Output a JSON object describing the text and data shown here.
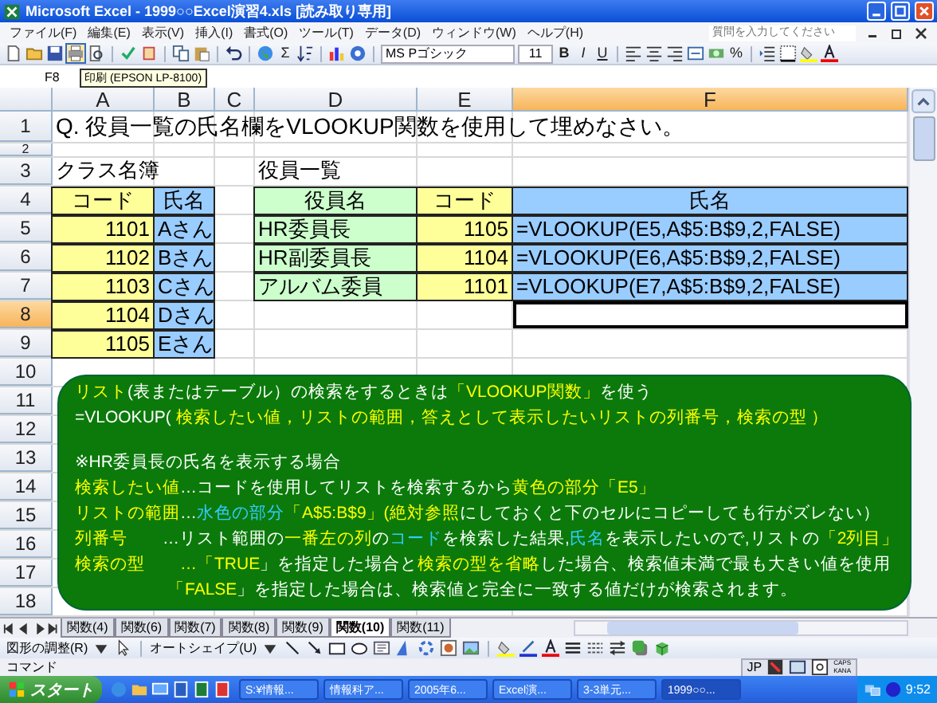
{
  "window": {
    "title": "Microsoft Excel - 1999○○Excel演習4.xls [読み取り専用]"
  },
  "menu": [
    "ファイル(F)",
    "編集(E)",
    "表示(V)",
    "挿入(I)",
    "書式(O)",
    "ツール(T)",
    "データ(D)",
    "ウィンドウ(W)",
    "ヘルプ(H)"
  ],
  "help_box": {
    "placeholder": "質問を入力してください"
  },
  "toolbar": {
    "font": "MS Pゴシック",
    "size": "11",
    "bold": "B",
    "italic": "I",
    "underline": "U",
    "sum": "Σ",
    "percent": "%"
  },
  "tooltip": "印刷 (EPSON LP-8100)",
  "name_box": "F8",
  "columns": [
    {
      "label": "A",
      "selected": false
    },
    {
      "label": "B",
      "selected": false
    },
    {
      "label": "C",
      "selected": false
    },
    {
      "label": "D",
      "selected": false
    },
    {
      "label": "E",
      "selected": false
    },
    {
      "label": "F",
      "selected": true
    }
  ],
  "rows": [
    {
      "label": "1",
      "selected": false,
      "A": {
        "text": "Q. 役員一覧の氏名欄をVLOOKUP関数を使用して埋めなさい。",
        "kind": "title"
      }
    },
    {
      "label": "2",
      "selected": false
    },
    {
      "label": "3",
      "selected": false,
      "A": {
        "text": "クラス名簿",
        "kind": "text"
      },
      "D": {
        "text": "役員一覧",
        "kind": "text"
      }
    },
    {
      "label": "4",
      "selected": false,
      "A": {
        "text": "コード",
        "kind": "header",
        "color": "#ffff99"
      },
      "B": {
        "text": "氏名",
        "kind": "header",
        "color": "#99ccff"
      },
      "D": {
        "text": "役員名",
        "kind": "header",
        "color": "#ccffcc"
      },
      "E": {
        "text": "コード",
        "kind": "header",
        "color": "#ffff99"
      },
      "F": {
        "text": "氏名",
        "kind": "header",
        "color": "#99ccff"
      }
    },
    {
      "label": "5",
      "selected": false,
      "A": {
        "text": "1101",
        "kind": "number",
        "color": "#ffff99"
      },
      "B": {
        "text": "Aさん",
        "kind": "text",
        "color": "#99ccff"
      },
      "D": {
        "text": "HR委員長",
        "kind": "text",
        "color": "#ccffcc"
      },
      "E": {
        "text": "1105",
        "kind": "number",
        "color": "#ffff99"
      },
      "F": {
        "text": "=VLOOKUP(E5,A$5:B$9,2,FALSE)",
        "kind": "text",
        "color": "#99ccff"
      }
    },
    {
      "label": "6",
      "selected": false,
      "A": {
        "text": "1102",
        "kind": "number",
        "color": "#ffff99"
      },
      "B": {
        "text": "Bさん",
        "kind": "text",
        "color": "#99ccff"
      },
      "D": {
        "text": "HR副委員長",
        "kind": "text",
        "color": "#ccffcc"
      },
      "E": {
        "text": "1104",
        "kind": "number",
        "color": "#ffff99"
      },
      "F": {
        "text": "=VLOOKUP(E6,A$5:B$9,2,FALSE)",
        "kind": "text",
        "color": "#99ccff"
      }
    },
    {
      "label": "7",
      "selected": false,
      "A": {
        "text": "1103",
        "kind": "number",
        "color": "#ffff99"
      },
      "B": {
        "text": "Cさん",
        "kind": "text",
        "color": "#99ccff"
      },
      "D": {
        "text": "アルバム委員",
        "kind": "text",
        "color": "#ccffcc"
      },
      "E": {
        "text": "1101",
        "kind": "number",
        "color": "#ffff99"
      },
      "F": {
        "text": "=VLOOKUP(E7,A$5:B$9,2,FALSE)",
        "kind": "text",
        "color": "#99ccff"
      }
    },
    {
      "label": "8",
      "selected": true,
      "A": {
        "text": "1104",
        "kind": "number",
        "color": "#ffff99"
      },
      "B": {
        "text": "Dさん",
        "kind": "text",
        "color": "#99ccff"
      },
      "F": {
        "selected": true
      }
    },
    {
      "label": "9",
      "selected": false,
      "A": {
        "text": "1105",
        "kind": "number",
        "color": "#ffff99"
      },
      "B": {
        "text": "Eさん",
        "kind": "text",
        "color": "#99ccff"
      }
    },
    {
      "label": "10",
      "selected": false
    },
    {
      "label": "11",
      "selected": false
    },
    {
      "label": "12",
      "selected": false
    },
    {
      "label": "13",
      "selected": false
    },
    {
      "label": "14",
      "selected": false
    },
    {
      "label": "15",
      "selected": false
    },
    {
      "label": "16",
      "selected": false
    },
    {
      "label": "17",
      "selected": false
    },
    {
      "label": "18",
      "selected": false
    }
  ],
  "note_box": {
    "lines": [
      {
        "kind": "line",
        "segments": [
          {
            "text": "リスト",
            "color": "#ffff00"
          },
          {
            "text": "(表またはテーブル）の検索をするときは",
            "color": "#ffffff"
          },
          {
            "text": "「VLOOKUP関数」",
            "color": "#ffff00"
          },
          {
            "text": "を使う",
            "color": "#ffffff"
          }
        ]
      },
      {
        "kind": "line",
        "segments": [
          {
            "text": "=VLOOKUP( ",
            "color": "#ffffff"
          },
          {
            "text": "検索したい値，リストの範囲，答えとして表示したいリストの列番号，検索の型 ）",
            "color": "#ffff00"
          }
        ]
      },
      {
        "kind": "section",
        "segments": [
          {
            "text": "※HR委員長の氏名を表示する場合",
            "color": "#ffffff"
          }
        ]
      },
      {
        "kind": "line",
        "segments": [
          {
            "text": "検索したい値",
            "color": "#ffff00"
          },
          {
            "text": "…コードを使用してリストを検索するから",
            "color": "#ffffff"
          },
          {
            "text": "黄色の部分「E5」",
            "color": "#ffff00"
          }
        ]
      },
      {
        "kind": "line",
        "segments": [
          {
            "text": "リストの範囲",
            "color": "#ffff00"
          },
          {
            "text": "…",
            "color": "#ffffff"
          },
          {
            "text": "水色の部分",
            "color": "#33ccff"
          },
          {
            "text": "「A$5:B$9」(絶対参照",
            "color": "#ffff00"
          },
          {
            "text": "にしておくと下のセルにコピーしても行がズレない）",
            "color": "#ffffff"
          }
        ]
      },
      {
        "kind": "line",
        "segments": [
          {
            "text": "列番号",
            "color": "#ffff00"
          },
          {
            "text": "　　…リスト範囲の",
            "color": "#ffffff"
          },
          {
            "text": "一番左の列",
            "color": "#ffff00"
          },
          {
            "text": "の",
            "color": "#ffffff"
          },
          {
            "text": "コード",
            "color": "#33ccff"
          },
          {
            "text": "を検索した結果,",
            "color": "#ffffff"
          },
          {
            "text": "氏名",
            "color": "#33ccff"
          },
          {
            "text": "を表示したいので,リストの",
            "color": "#ffffff"
          },
          {
            "text": "「2列目」",
            "color": "#ffff00"
          }
        ]
      },
      {
        "kind": "line",
        "segments": [
          {
            "text": "検索の型　　…「",
            "color": "#ffff00"
          },
          {
            "text": "TRUE",
            "color": "#ffff00"
          },
          {
            "text": "」を指定した場合と",
            "color": "#ffffff"
          },
          {
            "text": "検索の型を省略",
            "color": "#ffff00"
          },
          {
            "text": "した場合、検索値未満で最も大きい値を使用",
            "color": "#ffffff"
          }
        ]
      },
      {
        "kind": "continuation",
        "segments": [
          {
            "text": "「FALSE",
            "color": "#ffff00"
          },
          {
            "text": "」を指定した場合は、検索値と完全に一致する値だけが検索されます。",
            "color": "#ffffff"
          }
        ]
      }
    ]
  },
  "sheet_tabs": [
    {
      "label": "関数(4)",
      "selected": false
    },
    {
      "label": "関数(6)",
      "selected": false
    },
    {
      "label": "関数(7)",
      "selected": false
    },
    {
      "label": "関数(8)",
      "selected": false
    },
    {
      "label": "関数(9)",
      "selected": false
    },
    {
      "label": "関数(10)",
      "selected": true
    },
    {
      "label": "関数(11)",
      "selected": false
    }
  ],
  "drawing_toolbar": {
    "draw_menu": "図形の調整(R)",
    "autoshapes_menu": "オートシェイプ(U)"
  },
  "status_bar": {
    "text": "コマンド"
  },
  "language_bar": {
    "language": "JP",
    "caps": "CAPS",
    "kana": "KANA"
  },
  "taskbar": {
    "start": "スタート",
    "tasks": [
      {
        "label": "S:¥情報...",
        "selected": false
      },
      {
        "label": "情報科ア...",
        "selected": false
      },
      {
        "label": "2005年6...",
        "selected": false
      },
      {
        "label": "Excel演...",
        "selected": false
      },
      {
        "label": "3-3単元...",
        "selected": false
      },
      {
        "label": "1999○○...",
        "selected": true
      }
    ],
    "clock": "9:52"
  }
}
